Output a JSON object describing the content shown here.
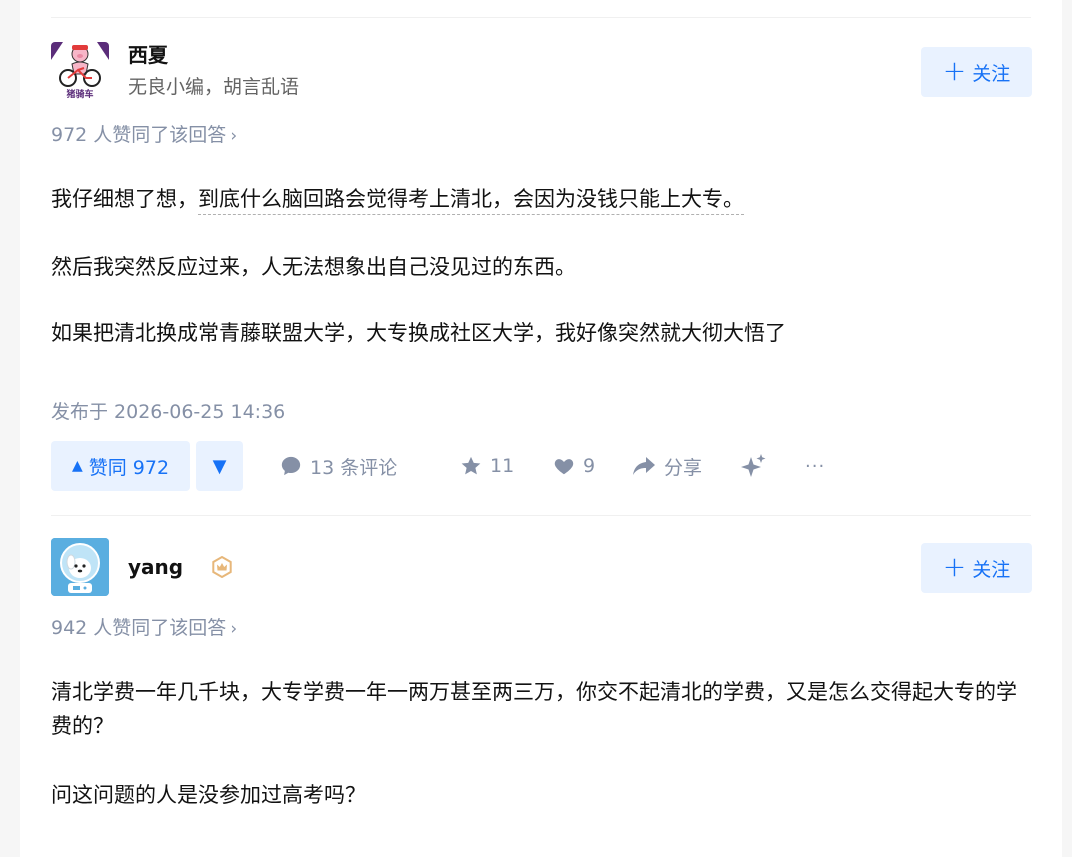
{
  "answers": [
    {
      "author": {
        "name": "西夏",
        "headline": "无良小编，胡言乱语",
        "avatar_caption": "猪骑车"
      },
      "follow_label": "关注",
      "vote_summary": "972 人赞同了该回答",
      "paragraphs": [
        {
          "before": "我仔细想了想，",
          "highlight": "到底什么脑回路会觉得考上清北，会因为没钱只能上大专。"
        },
        {
          "text": "然后我突然反应过来，人无法想象出自己没见过的东西。"
        },
        {
          "text": "如果把清北换成常青藤联盟大学，大专换成社区大学，我好像突然就大彻大悟了"
        }
      ],
      "published": "发布于 2026-06-25 14:36",
      "actions": {
        "upvote_label": "赞同 972",
        "comments_label": "13 条评论",
        "favorites_count": "11",
        "likes_count": "9",
        "share_label": "分享",
        "more_label": "···"
      }
    },
    {
      "author": {
        "name": "yang",
        "headline": ""
      },
      "follow_label": "关注",
      "vote_summary": "942 人赞同了该回答",
      "paragraphs": [
        {
          "text": "清北学费一年几千块，大专学费一年一两万甚至两三万，你交不起清北的学费，又是怎么交得起大专的学费的？"
        },
        {
          "text": "问这问题的人是没参加过高考吗？"
        }
      ]
    }
  ],
  "colors": {
    "brand_blue": "#1772f6",
    "button_bg": "#e9f2ff",
    "meta_gray": "#8590a6"
  }
}
